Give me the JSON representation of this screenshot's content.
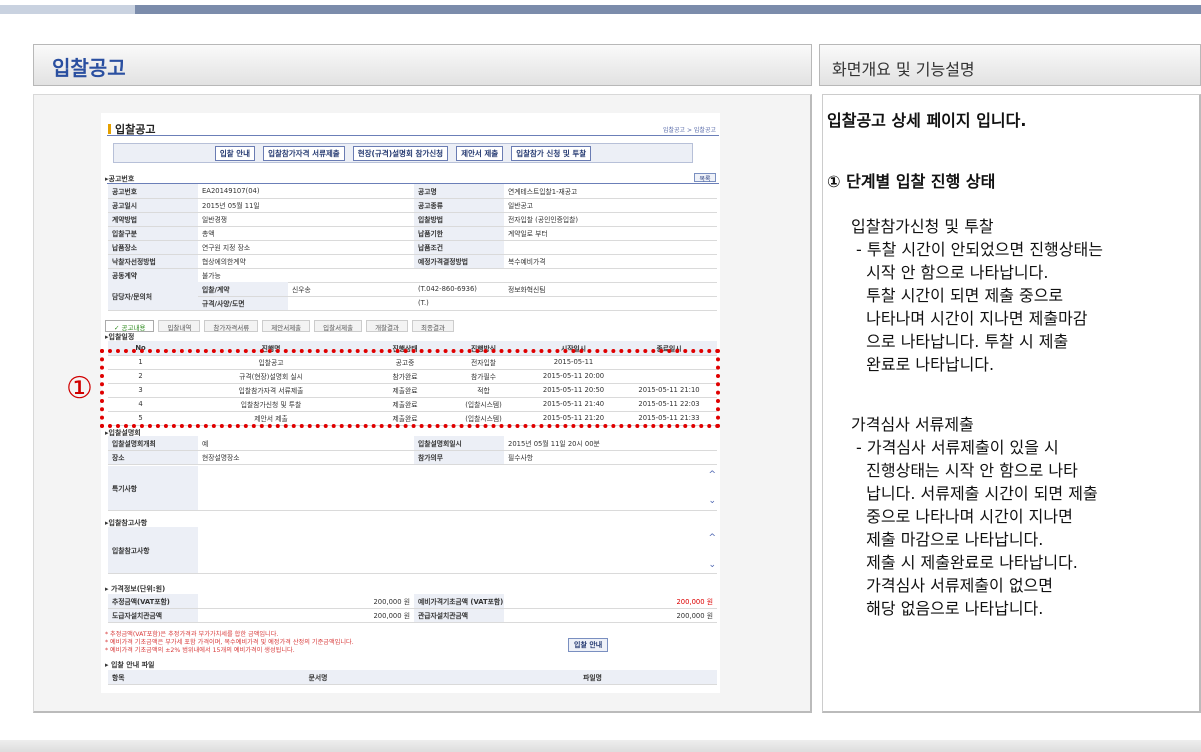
{
  "page": {
    "title": "입찰공고",
    "right_title": "화면개요 및 기능설명"
  },
  "shot": {
    "title": "입찰공고",
    "breadcrumb": "입찰공고 > 입찰공고",
    "tabs": [
      "입찰 안내",
      "입찰참가자격 서류제출",
      "현장(규격)설명회 참가신청",
      "제안서 제출",
      "입찰참가 신청 및 투찰"
    ],
    "section_notice": "▸공고번호",
    "list_button": "목록",
    "info_rows": [
      [
        "공고번호",
        "EA20149107(04)",
        "공고명",
        "연계테스트입찰1-재공고"
      ],
      [
        "공고일시",
        "2015년 05월 11일",
        "공고종류",
        "일반공고"
      ],
      [
        "계약방법",
        "일반경쟁",
        "입찰방법",
        "전자입찰 (공인인증입찰)"
      ],
      [
        "입찰구분",
        "총액",
        "납품기한",
        "계약일로 부터"
      ],
      [
        "납품장소",
        "연구원 지정 장소",
        "납품조건",
        ""
      ],
      [
        "낙찰자선정방법",
        "협상에의한계약",
        "예정가격결정방법",
        "복수예비가격"
      ],
      [
        "공동계약",
        "불가능",
        "",
        ""
      ]
    ],
    "contact": {
      "label": "담당자/문의처",
      "sub1": "입찰/계약",
      "name": "신우송",
      "tel1": "(T.042-860-6936)",
      "dept": "정보화혁신팀",
      "sub2": "규격/사양/도면",
      "tel2": "(T.)"
    },
    "progress_tabs": [
      "✓ 공고내용",
      "입찰내역",
      "참가자격서류",
      "제안서제출",
      "입찰서제출",
      "개찰결과",
      "최종결과"
    ],
    "section_schedule": "▸입찰일정",
    "schedule_header": [
      "No",
      "진행명",
      "진행상태",
      "진행방식",
      "시작일시",
      "종료일시"
    ],
    "schedule_rows": [
      [
        "1",
        "입찰공고",
        "공고중",
        "전자입찰",
        "2015-05-11",
        ""
      ],
      [
        "2",
        "규격(현장)설명회 실시",
        "참가완료",
        "참가필수",
        "2015-05-11 20:00",
        ""
      ],
      [
        "3",
        "입찰참가자격 서류제출",
        "제출완료",
        "적합",
        "2015-05-11 20:50",
        "2015-05-11 21:10"
      ],
      [
        "4",
        "입찰참가신청 및 투찰",
        "제출완료",
        "(입찰시스템)",
        "2015-05-11 21:40",
        "2015-05-11 22:03"
      ],
      [
        "5",
        "제안서 제출",
        "제출완료",
        "(입찰시스템)",
        "2015-05-11 21:20",
        "2015-05-11 21:33"
      ]
    ],
    "section_briefing": "▸입찰설명회",
    "briefing_rows": [
      [
        "입찰설명회개최",
        "예",
        "입찰설명회일시",
        "2015년 05월 11일 20시 00분"
      ],
      [
        "장소",
        "현장설명장소",
        "참가의무",
        "필수사항"
      ]
    ],
    "special_label": "특기사항",
    "section_ref": "▸입찰참고사항",
    "ref_label": "입찰참고사항",
    "section_price": "▸ 가격정보(단위:원)",
    "price_rows": [
      [
        "추정금액(VAT포함)",
        "200,000 원",
        "예비가격기초금액 (VAT포함)",
        "200,000 원"
      ],
      [
        "도급자설치관금액",
        "200,000 원",
        "관급자설치관금액",
        "200,000 원"
      ]
    ],
    "notes": [
      "* 추정금액(VAT포함)은 추정가격과 부가가치세를 합한 금액입니다.",
      "* 예비가격 기초금액은 부가세 포함 가격이며, 복수예비가격 및 예정가격 산정의 기준금액입니다.",
      "* 예비가격 기초금액의 ±2% 범위내에서 15개의 예비가격이 생성됩니다."
    ],
    "guide_button": "입찰 안내",
    "section_files": "▸ 입찰 안내 파일",
    "file_header": [
      "항목",
      "문서명",
      "파일명"
    ]
  },
  "marker": "①",
  "description": {
    "intro": "입찰공고 상세 페이지 입니다.",
    "step_title": "① 단계별 입찰 진행 상태",
    "block1_title": "입찰참가신청 및 투찰",
    "block1_lines": [
      "- 투찰 시간이 안되었으면 진행상태는",
      "  시작 안 함으로 나타납니다.",
      "  투찰 시간이 되면 제출 중으로",
      "  나타나며 시간이 지나면 제출마감",
      "  으로 나타납니다. 투찰 시 제출",
      "  완료로 나타납니다."
    ],
    "block2_title": "가격심사 서류제출",
    "block2_lines": [
      "- 가격심사 서류제출이 있을 시",
      "  진행상태는 시작 안 함으로 나타",
      "  납니다. 서류제출 시간이 되면 제출",
      "  중으로 나타나며 시간이 지나면",
      "  제출 마감으로 나타납니다.",
      "  제출 시 제출완료로 나타납니다.",
      "  가격심사 서류제출이 없으면",
      "  해당 없음으로 나타납니다."
    ]
  }
}
